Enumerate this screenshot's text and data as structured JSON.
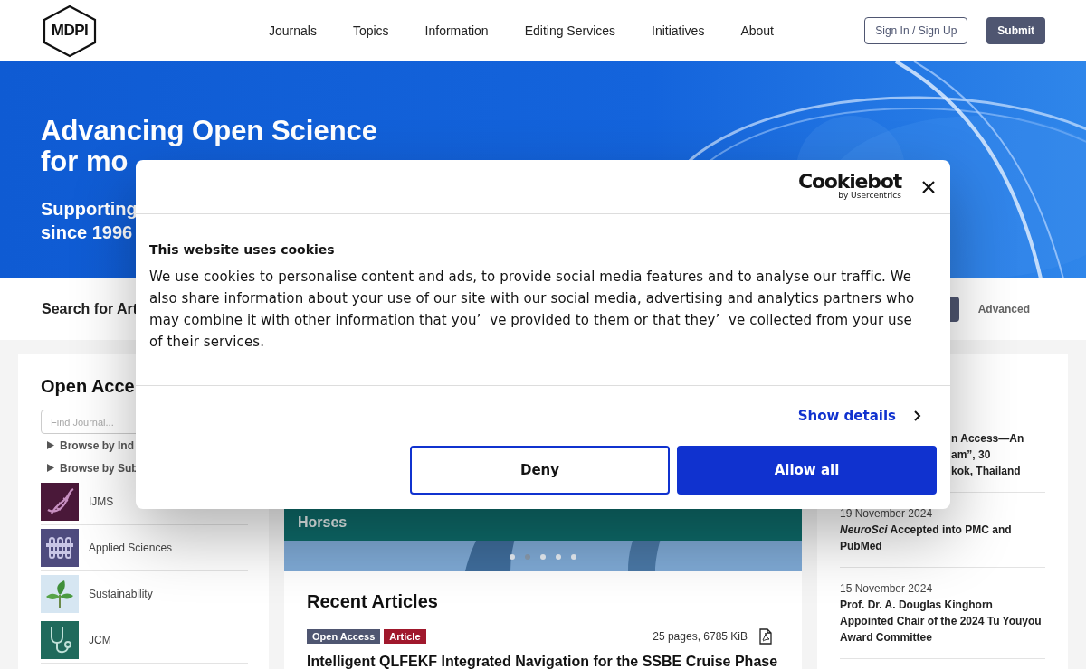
{
  "header": {
    "logo": "MDPI",
    "nav": [
      "Journals",
      "Topics",
      "Information",
      "Editing Services",
      "Initiatives",
      "About"
    ],
    "sign_in": "Sign In / Sign Up",
    "submit": "Submit"
  },
  "hero": {
    "title_lines": [
      "Advancing Open Science",
      "for mo"
    ],
    "subtitle_lines": [
      "Supporting",
      "since 1996"
    ]
  },
  "search": {
    "label": "Search for Art",
    "advanced": "Advanced"
  },
  "journals_panel": {
    "title": "Open Acce",
    "search_placeholder": "Find Journal...",
    "browse": [
      "Browse by Ind",
      "Browse by Sub"
    ],
    "journals": [
      {
        "name": "IJMS",
        "color": "#4a1839"
      },
      {
        "name": "Applied Sciences",
        "color": "#4e4b7e"
      },
      {
        "name": "Sustainability",
        "color": "#d6e6f2"
      },
      {
        "name": "JCM",
        "color": "#1f6a5c"
      }
    ]
  },
  "slider": {
    "caption": "Horses",
    "dots": [
      {
        "selected": false
      },
      {
        "selected": true
      },
      {
        "selected": false
      },
      {
        "selected": false
      },
      {
        "selected": false
      }
    ]
  },
  "recent_articles": {
    "title": "Recent Articles",
    "tags": [
      {
        "label": "Open Access",
        "color": "#4f5671"
      },
      {
        "label": "Article",
        "color": "#a0182c"
      }
    ],
    "meta": "25 pages, 6785 KiB",
    "article_title": "Intelligent QLFEKF Integrated Navigation for the SSBE Cruise Phase"
  },
  "news": [
    {
      "lines": [
        "n Access—An",
        "am”, 30",
        "kok, Thailand"
      ]
    },
    {
      "date": "19 November 2024",
      "text": "*NeuroSci* Accepted into PMC and PubMed"
    },
    {
      "date": "15 November 2024",
      "text": "Prof. Dr. A. Douglas Kinghorn Appointed Chair of the 2024 Tu Youyou Award Committee"
    }
  ],
  "cookie_dialog": {
    "brand": "Cookiebot",
    "brand_sub": "by Usercentrics",
    "title": "This website uses cookies",
    "body": "We use cookies to personalise content and ads, to provide social media features and to analyse our traffic. We also share information about your use of our site with our social media, advertising and analytics partners who may combine it with other information that you’  ve provided to them or that they’  ve collected from your use of their services.",
    "show_details": "Show details",
    "deny": "Deny",
    "allow": "Allow all"
  }
}
